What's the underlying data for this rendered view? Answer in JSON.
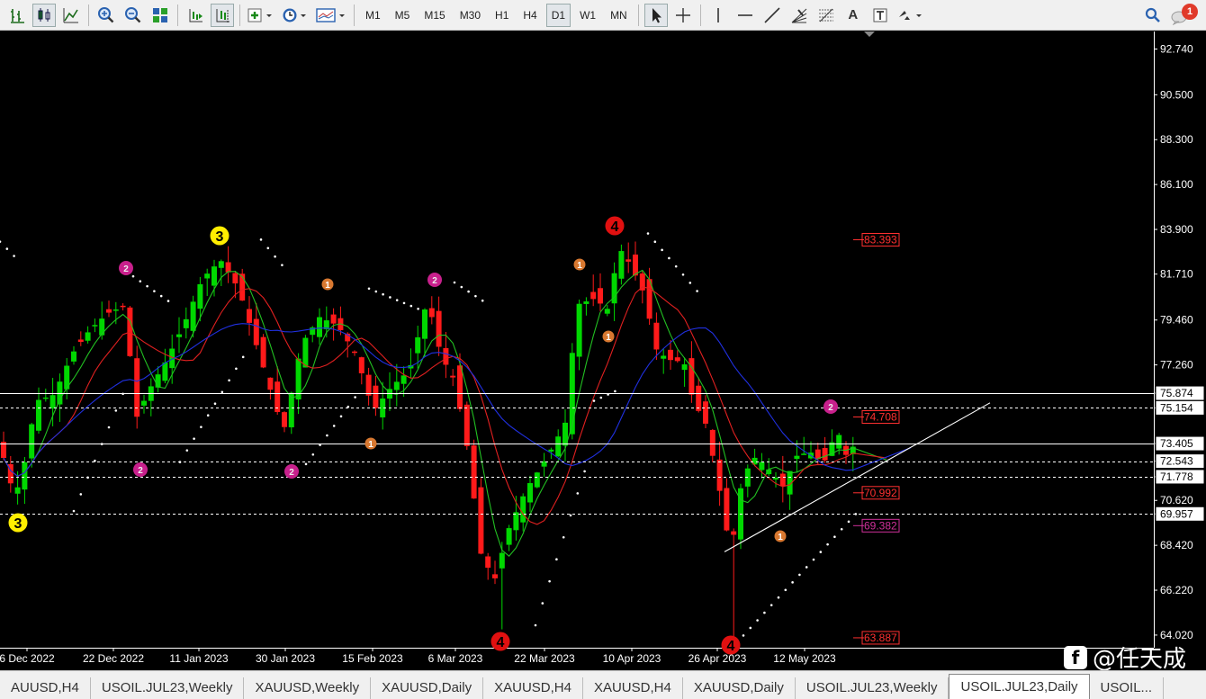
{
  "toolbar": {
    "timeframes": [
      "M1",
      "M5",
      "M15",
      "M30",
      "H1",
      "H4",
      "D1",
      "W1",
      "MN"
    ],
    "active_timeframe": "D1",
    "notification_count": "1",
    "text_tool": "A"
  },
  "chart_data": {
    "type": "candlestick",
    "symbol": "USOIL.JUL23",
    "period": "Daily",
    "ylim": [
      63.4,
      93.6
    ],
    "price_ticks": [
      "92.740",
      "90.500",
      "88.300",
      "86.100",
      "83.900",
      "81.710",
      "79.460",
      "77.260",
      "75.874",
      "75.154",
      "73.405",
      "72.543",
      "71.778",
      "70.620",
      "69.957",
      "68.420",
      "66.220",
      "64.020"
    ],
    "highlighted_prices": [
      "75.874",
      "75.154",
      "73.405",
      "72.543",
      "71.778",
      "69.957"
    ],
    "date_labels": [
      "6 Dec 2022",
      "22 Dec 2022",
      "11 Jan 2023",
      "30 Jan 2023",
      "15 Feb 2023",
      "6 Mar 2023",
      "22 Mar 2023",
      "10 Apr 2023",
      "26 Apr 2023",
      "12 May 2023"
    ],
    "horizontal_lines": [
      {
        "price": 75.874,
        "style": "solid"
      },
      {
        "price": 75.154,
        "style": "dashed"
      },
      {
        "price": 73.405,
        "style": "solid"
      },
      {
        "price": 72.543,
        "style": "dashed"
      },
      {
        "price": 71.778,
        "style": "dashed"
      },
      {
        "price": 69.957,
        "style": "dashed"
      }
    ],
    "level_labels": [
      {
        "text": "83.393",
        "color": "#ff3030"
      },
      {
        "text": "74.708",
        "color": "#ff3030"
      },
      {
        "text": "70.992",
        "color": "#ff3030"
      },
      {
        "text": "69.382",
        "color": "#d0309a"
      },
      {
        "text": "63.887",
        "color": "#ff3030"
      }
    ],
    "wave_markers": [
      {
        "label": "3",
        "color": "yellow"
      },
      {
        "label": "3",
        "color": "yellow"
      },
      {
        "label": "4",
        "color": "red"
      },
      {
        "label": "4",
        "color": "red"
      },
      {
        "label": "4",
        "color": "red"
      },
      {
        "label": "2",
        "color": "magenta"
      },
      {
        "label": "2",
        "color": "magenta"
      },
      {
        "label": "2",
        "color": "magenta"
      },
      {
        "label": "2",
        "color": "magenta"
      },
      {
        "label": "2",
        "color": "magenta"
      },
      {
        "label": "1",
        "color": "orange"
      },
      {
        "label": "1",
        "color": "orange"
      },
      {
        "label": "1",
        "color": "orange"
      },
      {
        "label": "1",
        "color": "orange"
      },
      {
        "label": "1",
        "color": "orange"
      }
    ]
  },
  "tabs": [
    "AUUSD,H4",
    "USOIL.JUL23,Weekly",
    "XAUUSD,Weekly",
    "XAUUSD,Daily",
    "XAUUSD,H4",
    "XAUUSD,H4",
    "XAUUSD,Daily",
    "USOIL.JUL23,Weekly",
    "USOIL.JUL23,Daily",
    "USOIL..."
  ],
  "active_tab": "USOIL.JUL23,Daily",
  "watermark": "@任天成"
}
